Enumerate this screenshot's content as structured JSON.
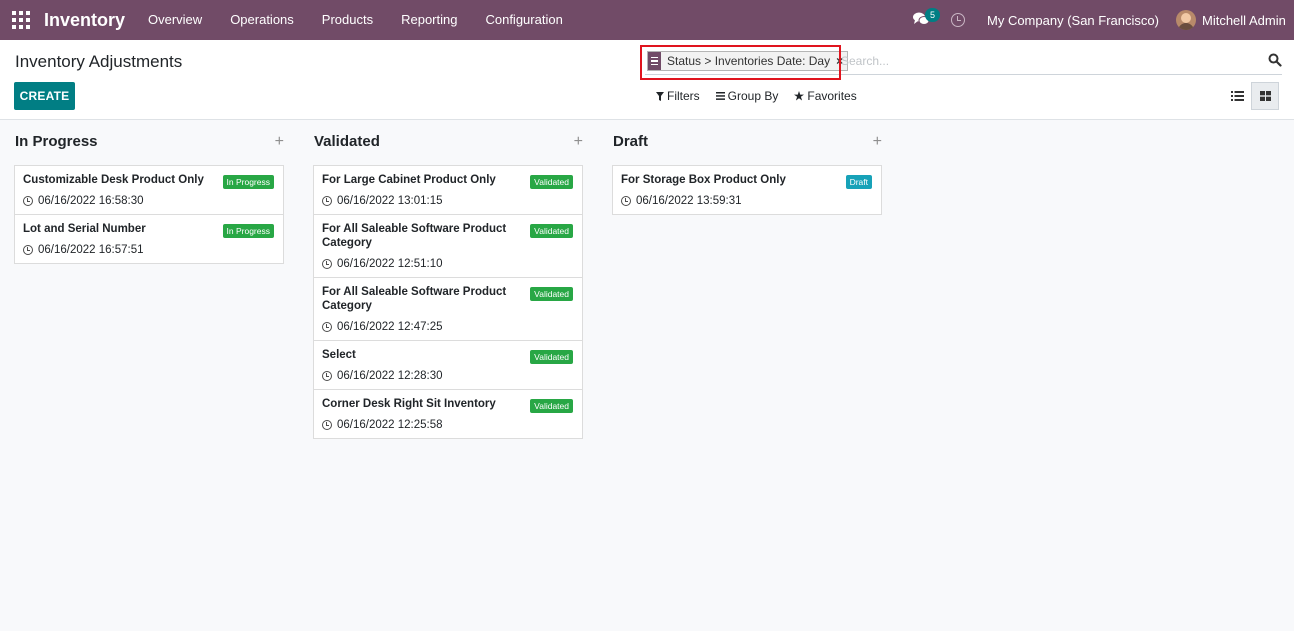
{
  "navbar": {
    "brand": "Inventory",
    "menu": [
      "Overview",
      "Operations",
      "Products",
      "Reporting",
      "Configuration"
    ],
    "chat_badge": "5",
    "company": "My Company (San Francisco)",
    "user": "Mitchell Admin"
  },
  "control_panel": {
    "title": "Inventory Adjustments",
    "create_label": "CREATE",
    "search": {
      "facet": "Status > Inventories Date: Day",
      "remove_glyph": "×",
      "placeholder": "Search..."
    },
    "filters_label": "Filters",
    "groupby_label": "Group By",
    "favorites_label": "Favorites"
  },
  "colors": {
    "brand": "#714b67",
    "primary": "#017e84",
    "badge_green": "#28a745",
    "badge_blue": "#17a2b8",
    "highlight": "#e0141e"
  },
  "columns": [
    {
      "title": "In Progress",
      "cards": [
        {
          "title": "Customizable Desk Product Only",
          "status": "In Progress",
          "date": "06/16/2022 16:58:30"
        },
        {
          "title": "Lot and Serial Number",
          "status": "In Progress",
          "date": "06/16/2022 16:57:51"
        }
      ]
    },
    {
      "title": "Validated",
      "cards": [
        {
          "title": "For Large Cabinet Product Only",
          "status": "Validated",
          "date": "06/16/2022 13:01:15"
        },
        {
          "title": "For All Saleable Software Product Category",
          "status": "Validated",
          "date": "06/16/2022 12:51:10"
        },
        {
          "title": "For All Saleable Software Product Category",
          "status": "Validated",
          "date": "06/16/2022 12:47:25"
        },
        {
          "title": "Select",
          "status": "Validated",
          "date": "06/16/2022 12:28:30"
        },
        {
          "title": "Corner Desk Right Sit Inventory",
          "status": "Validated",
          "date": "06/16/2022 12:25:58"
        }
      ]
    },
    {
      "title": "Draft",
      "cards": [
        {
          "title": "For Storage Box Product Only",
          "status": "Draft",
          "date": "06/16/2022 13:59:31"
        }
      ]
    }
  ]
}
